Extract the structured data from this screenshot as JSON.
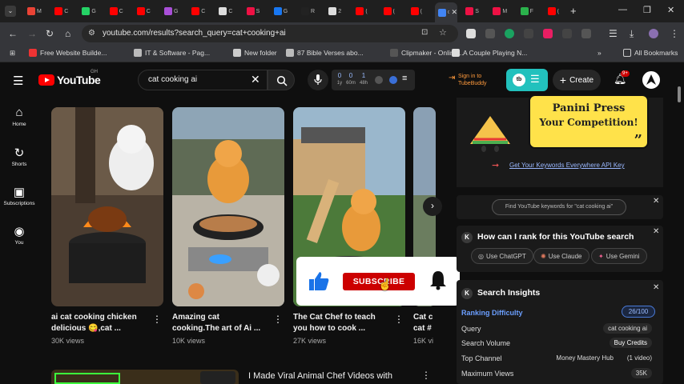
{
  "browser": {
    "tabs": [
      {
        "text": "M",
        "color": "#ea4335"
      },
      {
        "text": "C",
        "color": "#ff0000"
      },
      {
        "text": "G",
        "color": "#25d366"
      },
      {
        "text": "C",
        "color": "#ff0000"
      },
      {
        "text": "C",
        "color": "#ff0000"
      },
      {
        "text": "G",
        "color": "#a94fd8"
      },
      {
        "text": "C",
        "color": "#ff0000"
      },
      {
        "text": "C",
        "color": "#ddd"
      },
      {
        "text": "S",
        "color": "#e14"
      },
      {
        "text": "G",
        "color": "#1877f2"
      },
      {
        "text": "R",
        "color": "#222"
      },
      {
        "text": "2",
        "color": "#ddd"
      },
      {
        "text": "(",
        "color": "#ff0000"
      },
      {
        "text": "(",
        "color": "#ff0000"
      },
      {
        "text": "(",
        "color": "#ff0000"
      },
      {
        "text": "c",
        "color": "#4285f4"
      },
      {
        "text": "S",
        "color": "#e14"
      },
      {
        "text": "M",
        "color": "#e14"
      },
      {
        "text": "F",
        "color": "#2bb24c"
      },
      {
        "text": "(",
        "color": "#ff0000"
      }
    ],
    "url": "youtube.com/results?search_query=cat+cooking+ai",
    "bookmarks": [
      {
        "label": "Free Website Builde...",
        "color": "#e33"
      },
      {
        "label": "IT & Software - Pag...",
        "color": "#bbb"
      },
      {
        "label": "New folder",
        "color": "#ccc"
      },
      {
        "label": "87 Bible Verses abo...",
        "color": "#bbb"
      },
      {
        "label": "Clipmaker - Online...",
        "color": "#555"
      },
      {
        "label": "A Couple Playing N...",
        "color": "#ddd"
      }
    ],
    "all_bookmarks": "All Bookmarks"
  },
  "header": {
    "logo": "YouTube",
    "region": "GH",
    "search_value": "cat cooking ai",
    "stats": [
      {
        "value": "0",
        "sub": "1y"
      },
      {
        "value": "0",
        "sub": "60m"
      },
      {
        "value": "1",
        "sub": "48h"
      }
    ],
    "tubebuddy_signin": "Sign in to TubeBuddy",
    "tb_label": "tb",
    "create_label": "Create",
    "notif_badge": "9+"
  },
  "sidebar": [
    {
      "label": "Home",
      "icon": "⌂"
    },
    {
      "label": "Shorts",
      "icon": "↻"
    },
    {
      "label": "Subscriptions",
      "icon": "▣"
    },
    {
      "label": "You",
      "icon": "◉"
    }
  ],
  "videos": [
    {
      "title_l1": "ai cat cooking chicken",
      "title_l2": "delicious 😋,cat ...",
      "views": "30K views",
      "bg": "#5a4a3a"
    },
    {
      "title_l1": "Amazing cat",
      "title_l2": "cooking.The  art of Ai ...",
      "views": "10K views",
      "bg": "#7a93a8"
    },
    {
      "title_l1": "The Cat Chef to teach",
      "title_l2": "you how to cook ...",
      "views": "27K views",
      "bg": "#7e9a6a"
    },
    {
      "title_l1": "Cat c",
      "title_l2": "cat #",
      "views": "16K vi",
      "bg": "#8aa0b4"
    }
  ],
  "row2": {
    "title": "I Made Viral Animal Chef Videos with"
  },
  "subscribe": {
    "label": "SUBSCRIBE"
  },
  "panel": {
    "ad_line1": "Panini Press",
    "ad_line2": "Your Competition!",
    "ad_quote": "”",
    "ad_link": "Get Your Keywords Everywhere API Key",
    "kw_prompt": "Find YouTube keywords for \"cat cooking ai\"",
    "rank_title": "How can I rank for this YouTube search",
    "chips": [
      {
        "label": "Use ChatGPT",
        "icon": "◎"
      },
      {
        "label": "Use Claude",
        "icon": "✺"
      },
      {
        "label": "Use Gemini",
        "icon": "✦"
      }
    ],
    "insights_title": "Search Insights",
    "ranking_difficulty_label": "Ranking Difficulty",
    "ranking_difficulty_value": "26/100",
    "rows": [
      {
        "label": "Query",
        "value": "cat cooking ai"
      },
      {
        "label": "Search Volume",
        "value": "Buy Credits"
      },
      {
        "label": "Top Channel",
        "value": "Money Mastery Hub",
        "extra": "(1 video)"
      },
      {
        "label": "Maximum Views",
        "value": "35K"
      }
    ],
    "k_letter": "K"
  },
  "colors": {
    "yt_red": "#ff0000",
    "subscribe_red": "#cc0000",
    "tubebuddy_teal": "#22c1bd",
    "ad_yellow": "#ffe24a",
    "link_blue": "#9ab8ff"
  }
}
